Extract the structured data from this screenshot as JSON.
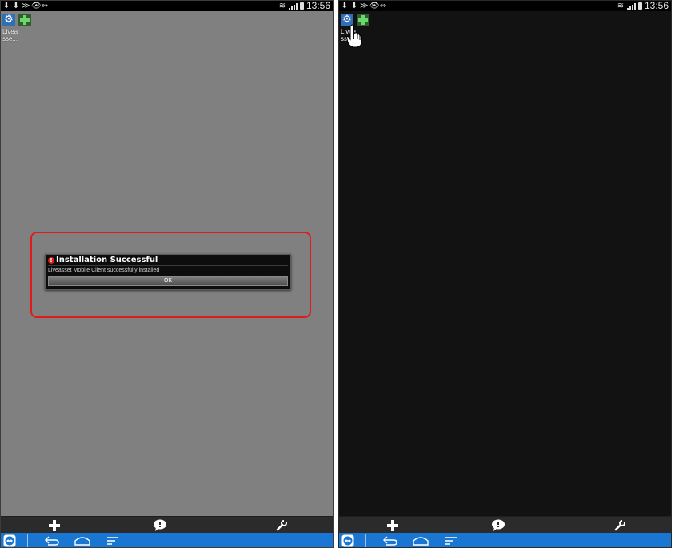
{
  "status_bar": {
    "time": "13:56",
    "left_icons": [
      "download-icon",
      "download-icon",
      "wifi-signal-icon",
      "eye-icon",
      "teamviewer-icon"
    ]
  },
  "desktop": {
    "app_label_line1": "Livea",
    "app_label_line2": "sse..."
  },
  "dialog": {
    "title": "Installation Successful",
    "message": "Liveasset Mobile Client successfully installed",
    "ok_label": "OK"
  },
  "action_bar": {
    "icons": [
      "plus-icon",
      "chat-bubble-icon",
      "wrench-icon"
    ]
  },
  "nav_bar": {
    "icons": [
      "teamviewer-icon",
      "back-icon",
      "home-icon",
      "recents-icon"
    ]
  },
  "colors": {
    "left_background": "#808080",
    "right_background": "#121212",
    "nav_blue": "#1976d2",
    "highlight_red": "#e01b1b"
  }
}
